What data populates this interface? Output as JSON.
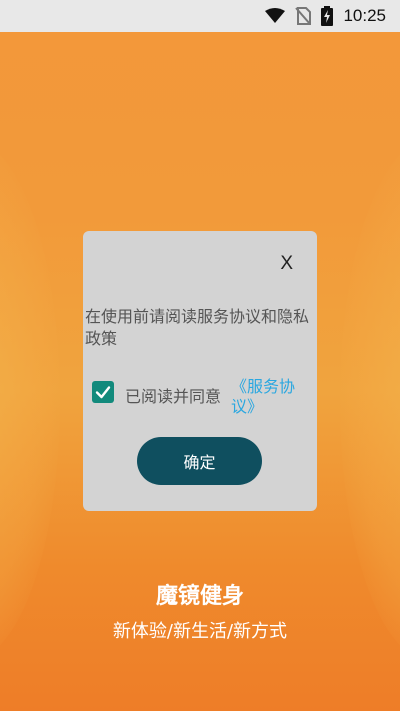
{
  "status_bar": {
    "time": "10:25",
    "icons": [
      "wifi-icon",
      "no-sim-icon",
      "battery-charging-icon"
    ]
  },
  "dialog": {
    "close_label": "X",
    "message": "在使用前请阅读服务协议和隐私政策",
    "agree_checked": true,
    "agree_label": "已阅读并同意",
    "agree_link": "《服务协议》",
    "confirm_label": "确定"
  },
  "brand": {
    "title": "魔镜健身",
    "subtitle": "新体验/新生活/新方式"
  },
  "colors": {
    "background": "#f29a3a",
    "dialog_bg": "#d3d3d3",
    "checkbox": "#128a7c",
    "link": "#2aa7e0",
    "confirm_button": "#0f4f5f"
  }
}
